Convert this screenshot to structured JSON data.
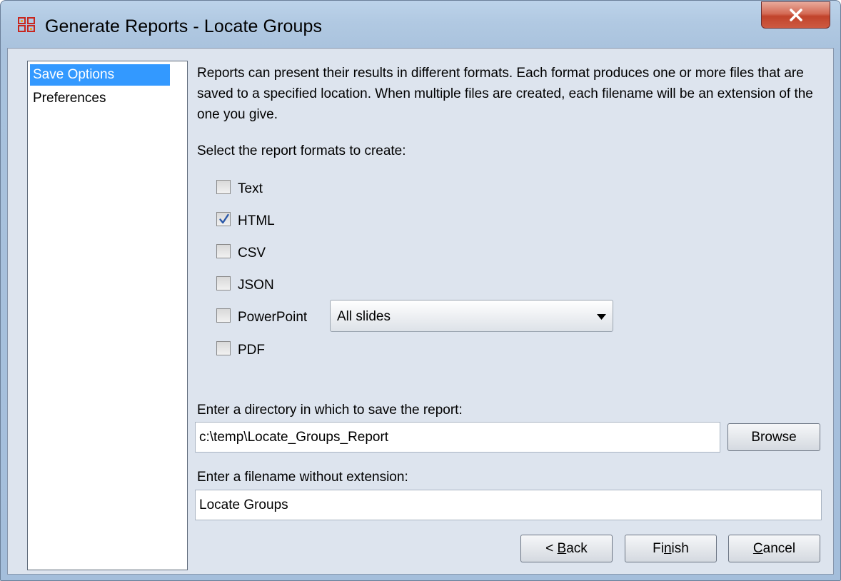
{
  "window": {
    "title": "Generate Reports - Locate Groups"
  },
  "nav": {
    "items": [
      {
        "label": "Save Options",
        "selected": true
      },
      {
        "label": "Preferences",
        "selected": false
      }
    ]
  },
  "description": "Reports can present their results in different formats. Each format produces one or more files that are saved to a specified location. When multiple files are created, each filename will be an extension of the one you give.",
  "formats_label": "Select the report formats to create:",
  "formats": [
    {
      "label": "Text",
      "checked": false
    },
    {
      "label": "HTML",
      "checked": true
    },
    {
      "label": "CSV",
      "checked": false
    },
    {
      "label": "JSON",
      "checked": false
    },
    {
      "label": "PowerPoint",
      "checked": false
    },
    {
      "label": "PDF",
      "checked": false
    }
  ],
  "powerpoint_select": {
    "value": "All slides"
  },
  "directory": {
    "label": "Enter a directory in which to save the report:",
    "value": "c:\\temp\\Locate_Groups_Report",
    "browse_label": "Browse"
  },
  "filename": {
    "label": "Enter a filename without extension:",
    "value": "Locate Groups"
  },
  "buttons": {
    "back": {
      "prefix": "< ",
      "mnemonic": "B",
      "rest": "ack"
    },
    "finish": {
      "prefix": "Fi",
      "mnemonic": "n",
      "rest": "ish"
    },
    "cancel": {
      "prefix": "",
      "mnemonic": "C",
      "rest": "ancel"
    }
  },
  "icons": {
    "app": "app-grid-icon",
    "close": "close-icon",
    "check": "check-icon",
    "dropdown": "dropdown-arrow-icon"
  }
}
